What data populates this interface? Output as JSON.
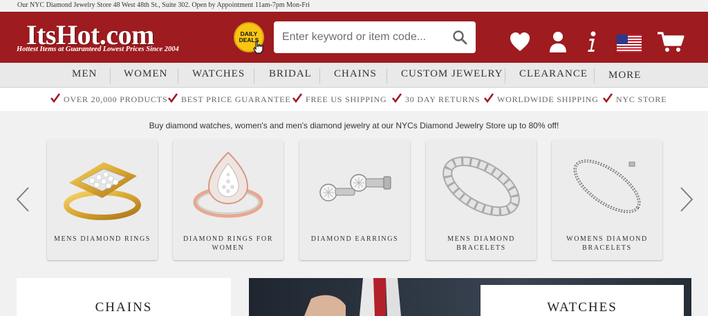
{
  "topbar": {
    "text": "Our NYC Diamond Jewelry Store 48 West 48th St., Suite 302. Open by Appointment 11am-7pm Mon-Fri"
  },
  "header": {
    "logo": "ItsHot.com",
    "tagline": "Hottest Items at Guaranteed Lowest Prices Since 2004",
    "deals_line1": "DAILY",
    "deals_line2": "DEALS",
    "search_placeholder": "Enter keyword or item code...",
    "colors": {
      "brand": "#9e1b1f",
      "deals": "#f7c614"
    },
    "icons": [
      "heart-icon",
      "user-icon",
      "info-icon",
      "us-flag-icon",
      "cart-icon"
    ]
  },
  "nav": {
    "items": [
      {
        "label": "MEN"
      },
      {
        "label": "WOMEN"
      },
      {
        "label": "WATCHES"
      },
      {
        "label": "BRIDAL"
      },
      {
        "label": "CHAINS"
      },
      {
        "label": "CUSTOM JEWELRY"
      },
      {
        "label": "CLEARANCE"
      },
      {
        "label": "MORE"
      }
    ]
  },
  "perks": [
    {
      "label": "OVER 20,000 PRODUCTS"
    },
    {
      "label": "BEST PRICE GUARANTEE"
    },
    {
      "label": "FREE US SHIPPING"
    },
    {
      "label": "30 DAY RETURNS"
    },
    {
      "label": "WORLDWIDE SHIPPING"
    },
    {
      "label": "NYC STORE"
    }
  ],
  "promo": {
    "text": "Buy diamond watches, women's and men's diamond jewelry at our NYCs Diamond Jewelry Store up to 80% off!"
  },
  "categories": [
    {
      "line1": "MENS DIAMOND RINGS",
      "line2": ""
    },
    {
      "line1": "DIAMOND RINGS FOR",
      "line2": "WOMEN"
    },
    {
      "line1": "DIAMOND EARRINGS",
      "line2": ""
    },
    {
      "line1": "MENS DIAMOND",
      "line2": "BRACELETS"
    },
    {
      "line1": "WOMENS DIAMOND",
      "line2": "BRACELETS"
    }
  ],
  "banners": {
    "chains": "CHAINS",
    "watches": "WATCHES"
  }
}
